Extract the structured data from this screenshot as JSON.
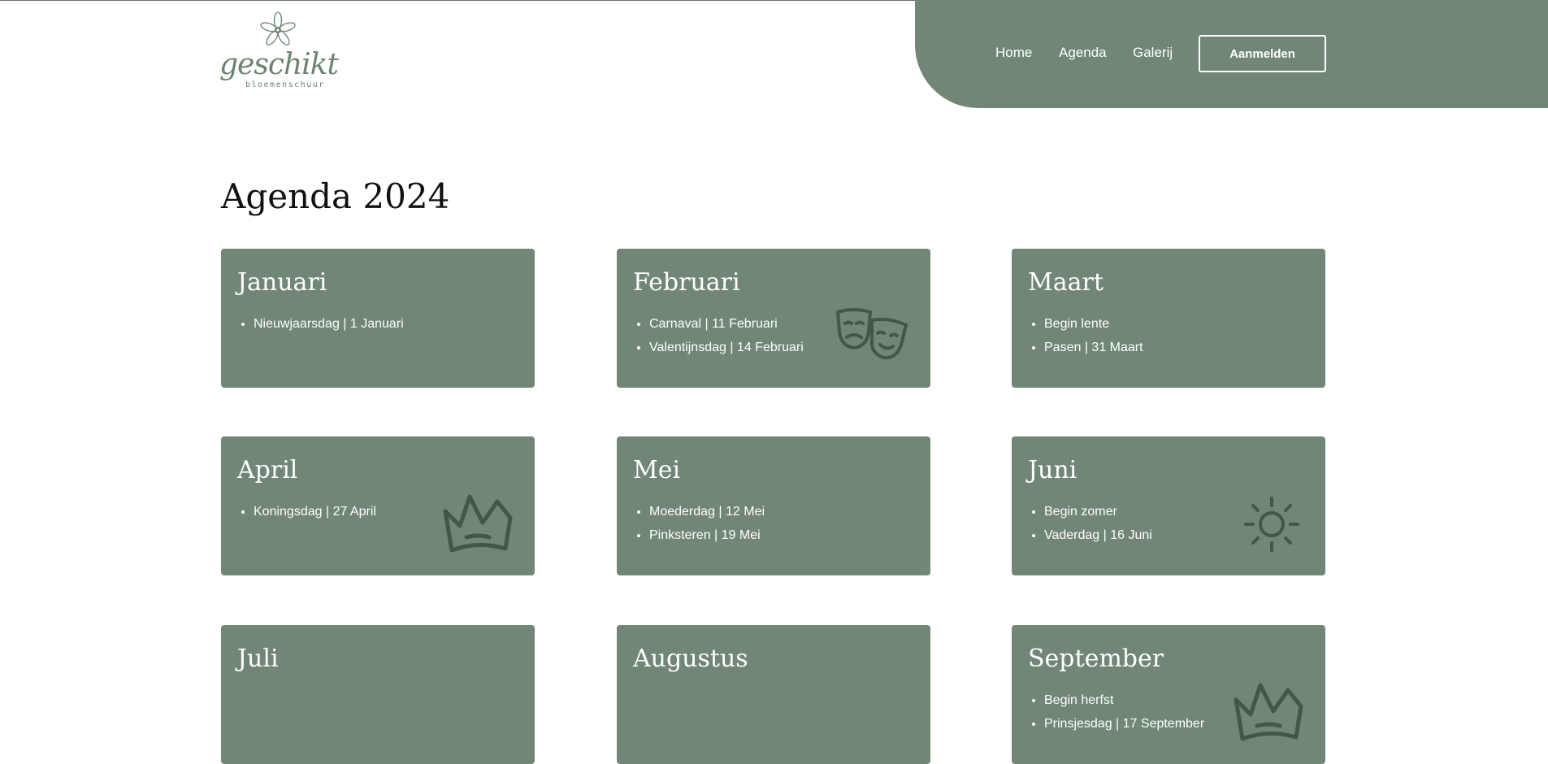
{
  "brand": {
    "name": "geschikt",
    "tagline": "bloemenschuur",
    "color": "#718676"
  },
  "nav": {
    "home": "Home",
    "agenda": "Agenda",
    "galerij": "Galerij",
    "login_button": "Aanmelden"
  },
  "page": {
    "title": "Agenda 2024"
  },
  "months": [
    {
      "name": "Januari",
      "items": [
        "Nieuwjaarsdag | 1 Januari"
      ],
      "icon": ""
    },
    {
      "name": "Februari",
      "items": [
        "Carnaval | 11 Februari",
        "Valentijnsdag | 14 Februari"
      ],
      "icon": "theater-masks-icon"
    },
    {
      "name": "Maart",
      "items": [
        "Begin lente",
        "Pasen | 31 Maart"
      ],
      "icon": ""
    },
    {
      "name": "April",
      "items": [
        "Koningsdag | 27 April"
      ],
      "icon": "crown-icon"
    },
    {
      "name": "Mei",
      "items": [
        "Moederdag | 12 Mei",
        "Pinksteren | 19 Mei"
      ],
      "icon": ""
    },
    {
      "name": "Juni",
      "items": [
        "Begin zomer",
        "Vaderdag | 16 Juni"
      ],
      "icon": "sun-icon"
    },
    {
      "name": "Juli",
      "items": [],
      "icon": ""
    },
    {
      "name": "Augustus",
      "items": [],
      "icon": ""
    },
    {
      "name": "September",
      "items": [
        "Begin herfst",
        "Prinsjesdag | 17 September"
      ],
      "icon": "crown-icon"
    }
  ]
}
